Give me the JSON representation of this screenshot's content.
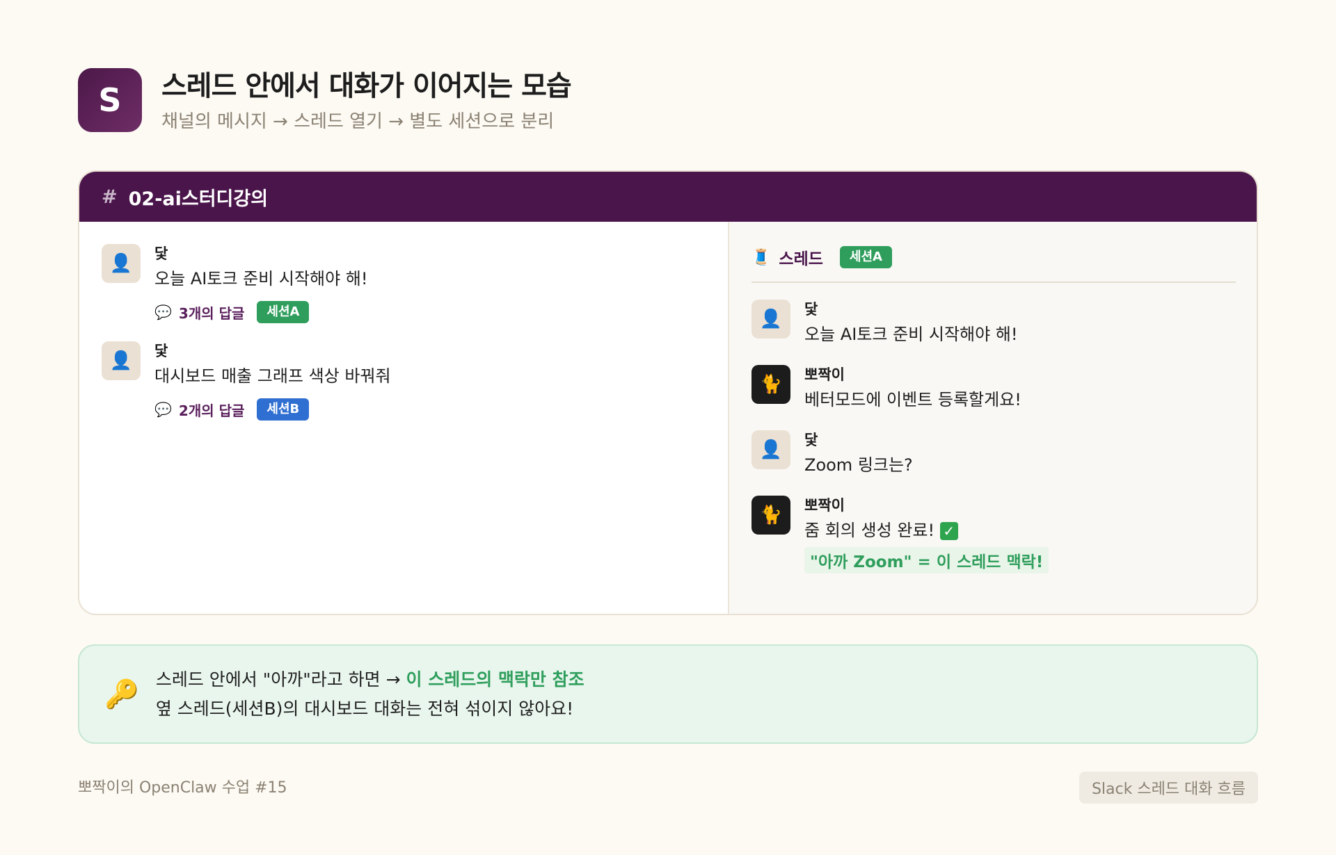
{
  "header": {
    "logo_letter": "S",
    "title": "스레드 안에서 대화가 이어지는 모습",
    "subtitle": "채널의 메시지 → 스레드 열기 → 별도 세션으로 분리"
  },
  "channel": {
    "hash": "#",
    "name": "02-ai스터디강의"
  },
  "channel_messages": [
    {
      "avatar_icon": "user-icon",
      "sender": "닻",
      "text": "오늘 AI토크 준비 시작해야 해!",
      "reply_icon": "speech-bubble-icon",
      "reply_count": "3개의 답글",
      "session": "세션A",
      "session_color": "#2f9e5c"
    },
    {
      "avatar_icon": "user-icon",
      "sender": "닻",
      "text": "대시보드 매출 그래프 색상 바꿔줘",
      "reply_icon": "speech-bubble-icon",
      "reply_count": "2개의 답글",
      "session": "세션B",
      "session_color": "#2f6fd1"
    }
  ],
  "thread": {
    "icon": "spool-icon",
    "label": "스레드",
    "session": "세션A",
    "messages": [
      {
        "avatar_icon": "user-icon",
        "sender": "닻",
        "text": "오늘 AI토크 준비 시작해야 해!"
      },
      {
        "avatar_icon": "cat-icon",
        "sender": "뽀짝이",
        "text": "베터모드에 이벤트 등록할게요!"
      },
      {
        "avatar_icon": "user-icon",
        "sender": "닻",
        "text": "Zoom 링크는?"
      },
      {
        "avatar_icon": "cat-icon",
        "sender": "뽀짝이",
        "text": "줌 회의 생성 완료!",
        "check_icon": "check-icon",
        "highlight": "\"아까 Zoom\" = 이 스레드 맥락!"
      }
    ]
  },
  "info": {
    "icon": "key-icon",
    "line1_prefix": "스레드 안에서 \"아까\"라고 하면 → ",
    "line1_strong": "이 스레드의 맥락만 참조",
    "line2": "옆 스레드(세션B)의 대시보드 대화는 전혀 섞이지 않아요!"
  },
  "footer": {
    "left": "뽀짝이의 OpenClaw 수업 #15",
    "right": "Slack 스레드 대화 흐름"
  },
  "colors": {
    "channel_bar": "#4a154b",
    "session_a": "#2f9e5c",
    "session_b": "#2f6fd1",
    "accent_green": "#2f9e5c"
  }
}
